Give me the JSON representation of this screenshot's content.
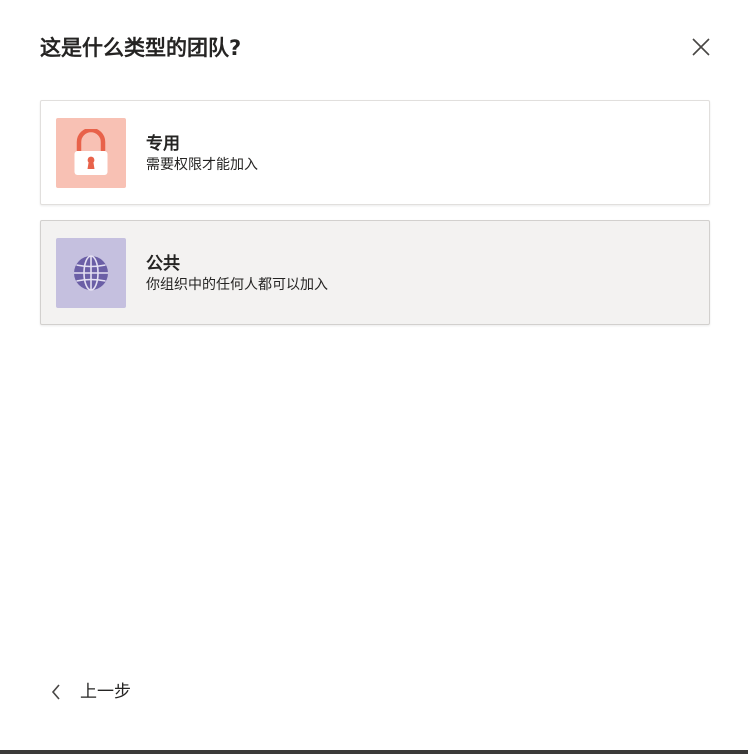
{
  "dialog": {
    "title": "这是什么类型的团队?",
    "close_icon": "close-icon"
  },
  "options": [
    {
      "title": "专用",
      "description": "需要权限才能加入",
      "icon": "lock-icon",
      "icon_bg": "#f8c1b4",
      "icon_color": "#e8624a",
      "state": "default"
    },
    {
      "title": "公共",
      "description": "你组织中的任何人都可以加入",
      "icon": "globe-icon",
      "icon_bg": "#c5c0df",
      "icon_color": "#6b5fa6",
      "state": "hovered"
    }
  ],
  "footer": {
    "back_label": "上一步",
    "back_icon": "chevron-left-icon"
  }
}
